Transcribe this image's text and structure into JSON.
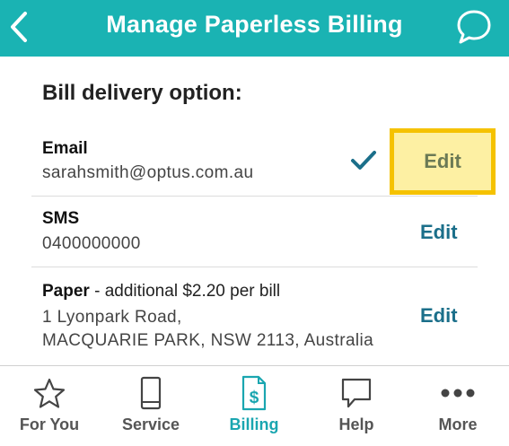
{
  "header": {
    "title": "Manage Paperless Billing",
    "back_icon": "chevron-left-icon",
    "chat_icon": "chat-bubble-icon",
    "color": "#1ab3b3"
  },
  "section": {
    "title": "Bill delivery option:"
  },
  "options": {
    "email": {
      "title": "Email",
      "value": "sarahsmith@optus.com.au",
      "selected": true,
      "edit_label": "Edit"
    },
    "sms": {
      "title": "SMS",
      "value": "0400000000",
      "edit_label": "Edit"
    },
    "paper": {
      "title": "Paper",
      "note": " - additional $2.20 per bill",
      "address_line1": "1 Lyonpark Road,",
      "address_line2": "MACQUARIE PARK, NSW 2113, Australia",
      "edit_label": "Edit"
    }
  },
  "highlight": {
    "border_color": "#f5c200",
    "fill_color": "#fdf0a3"
  },
  "nav": {
    "items": [
      {
        "label": "For You",
        "icon": "star-icon"
      },
      {
        "label": "Service",
        "icon": "phone-icon"
      },
      {
        "label": "Billing",
        "icon": "bill-dollar-icon",
        "active": true
      },
      {
        "label": "Help",
        "icon": "help-bubble-icon"
      },
      {
        "label": "More",
        "icon": "more-dots-icon"
      }
    ],
    "active_color": "#1aa6b0"
  }
}
